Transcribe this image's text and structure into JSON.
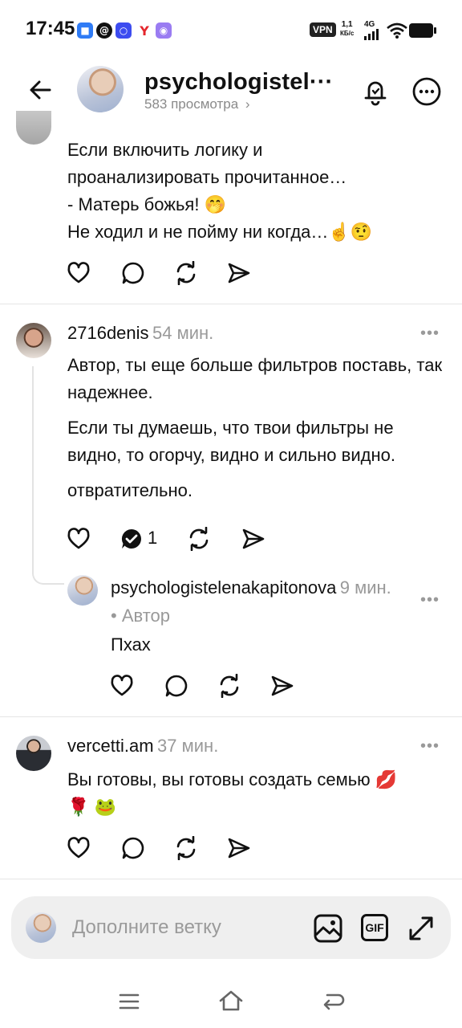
{
  "status_bar": {
    "time": "17:45",
    "vpn": "VPN",
    "speed": "1,1",
    "speed_unit": "КБ/с",
    "network": "4G",
    "icons": [
      "app-notify-icon",
      "threads-icon",
      "browser-icon",
      "yandex-icon",
      "app-purple-icon",
      "signal-icon",
      "wifi-icon",
      "battery-icon"
    ]
  },
  "header": {
    "username": "psychologistel···",
    "views": "583 просмотра",
    "back_icon": "arrow-left-icon",
    "bell_icon": "bell-icon",
    "more_icon": "more-icon"
  },
  "comments": [
    {
      "text_lines": [
        "Если включить логику и",
        "проанализировать прочитанное…",
        "- Матерь божья! 🤭",
        "Не ходил и не пойму ни когда…☝️🤨"
      ]
    },
    {
      "username": "2716denis",
      "time": "54 мин.",
      "paragraphs": [
        "Автор, ты еще больше фильтров поставь, так надежнее.",
        "Если ты думаешь, что твои фильтры не видно, то огорчу, видно и сильно видно.",
        "отвратительно."
      ],
      "replies_count": "1",
      "reply": {
        "username": "psychologistelenakapitonova",
        "time": "9 мин.",
        "author_badge": "• Автор",
        "text": "Пхах"
      }
    },
    {
      "username": "vercetti.am",
      "time": "37 мин.",
      "text_lines": [
        "Вы готовы, вы готовы создать семью 💋",
        "🌹 🐸"
      ]
    }
  ],
  "composer": {
    "placeholder": "Дополните ветку",
    "gif_label": "GIF"
  },
  "colors": {
    "accent_gif": "#111111",
    "muted": "#999999",
    "composer_bg": "#efefef"
  }
}
